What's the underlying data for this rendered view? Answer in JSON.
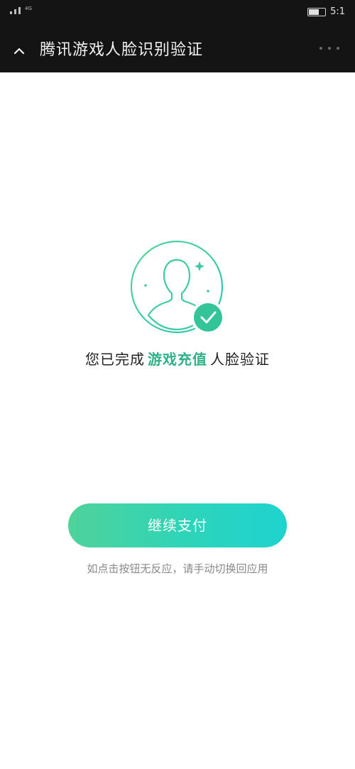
{
  "status_bar": {
    "network_type": "4G",
    "time": "5:1"
  },
  "nav": {
    "title": "腾讯游戏人脸识别验证",
    "back_icon": "chevron-up-icon",
    "more_icon": "more-dots-icon"
  },
  "result": {
    "prefix": "您已完成",
    "highlight": "游戏充值",
    "suffix": "人脸验证",
    "accent_color": "#2fb187"
  },
  "actions": {
    "continue_label": "继续支付"
  },
  "hint": {
    "text": "如点击按钮无反应，请手动切换回应用"
  },
  "colors": {
    "header_bg": "#141414",
    "button_gradient_start": "#4fd39a",
    "button_gradient_end": "#1ed3cf"
  }
}
